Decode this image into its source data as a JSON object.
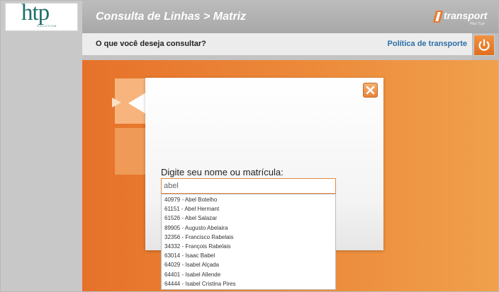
{
  "logo": {
    "text": "htp",
    "subtext": "SOLUTION"
  },
  "header": {
    "title": "Consulta de Linhas > Matriz"
  },
  "brand": {
    "text": "transport",
    "tagline": "Plus Ti.pr"
  },
  "subbar": {
    "question": "O que você deseja consultar?",
    "policy_link": "Política de transporte"
  },
  "modal": {
    "prompt": "Digite seu nome ou matrícula:",
    "input_value": "abel",
    "close_label": "close"
  },
  "suggestions": [
    "40979 - Abel Botelho",
    "61151 - Abel Hermant",
    "61526 - Abel Salazar",
    "89905 - Augusto Abelaira",
    "32356 - Francisco Rabelais",
    "34332 - François Rabelais",
    "63014 - Isaac Babel",
    "64029 - Isabel Alçada",
    "64401 - Isabel Allende",
    "64444 - Isabel Cristina Pires"
  ],
  "colors": {
    "accent": "#e8782a",
    "link": "#2d6fa8",
    "header": "#b3b3b3"
  }
}
